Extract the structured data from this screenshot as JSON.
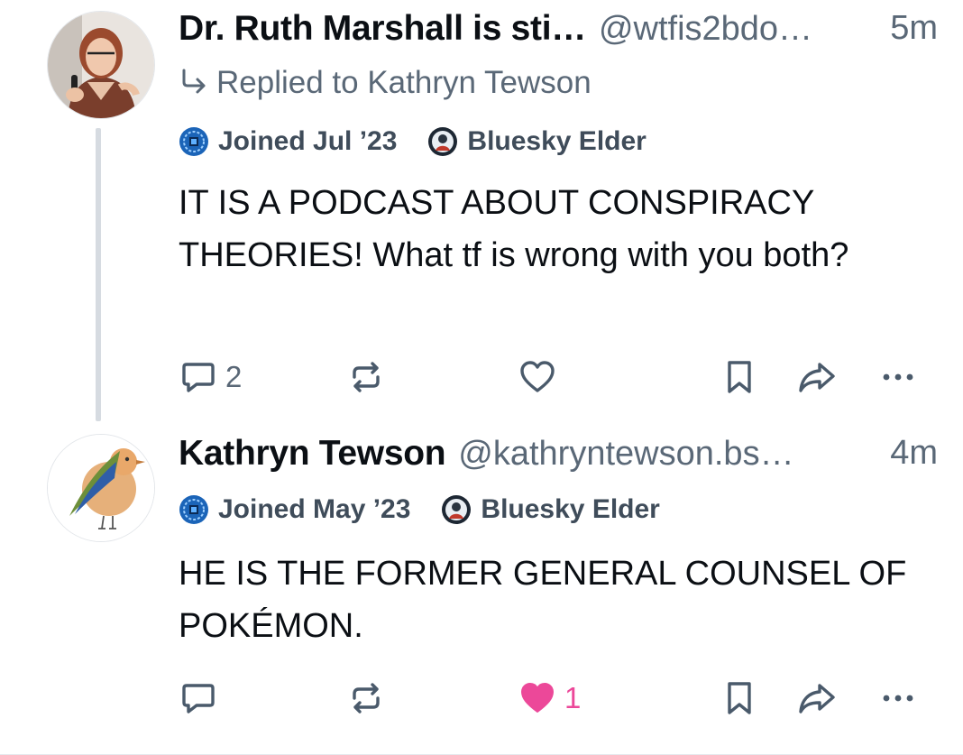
{
  "posts": [
    {
      "author_name": "Dr. Ruth Marshall is sti…",
      "handle": "@wtfis2bdo…",
      "time": "5m",
      "reply_to": "Replied to Kathryn Tewson",
      "badges": [
        {
          "label": "Joined Jul ’23",
          "icon": "joined-badge-icon"
        },
        {
          "label": "Bluesky Elder",
          "icon": "elder-badge-icon"
        }
      ],
      "text": "IT IS A PODCAST ABOUT CONSPIRACY THEORIES! What tf is wrong with you both?",
      "reply_count": "2",
      "like_count": ""
    },
    {
      "author_name": "Kathryn Tewson",
      "handle": "@kathryntewson.bs…",
      "time": "4m",
      "badges": [
        {
          "label": "Joined May ’23",
          "icon": "joined-badge-icon"
        },
        {
          "label": "Bluesky Elder",
          "icon": "elder-badge-icon"
        }
      ],
      "text": "HE IS THE FORMER GENERAL COUNSEL OF POKÉMON.",
      "reply_count": "",
      "like_count": "1"
    }
  ],
  "colors": {
    "muted": "#5a6877",
    "icon": "#4a5a6b",
    "like_active": "#ec4899",
    "thread_line": "#d6dbe1"
  }
}
